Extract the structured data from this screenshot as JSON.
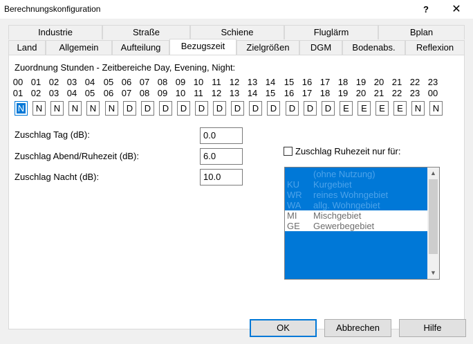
{
  "window": {
    "title": "Berechnungskonfiguration",
    "help_glyph": "?",
    "close_glyph": "✕"
  },
  "tabs": {
    "top_row": [
      "Industrie",
      "Straße",
      "Schiene",
      "Fluglärm",
      "Bplan"
    ],
    "bottom_row": [
      "Land",
      "Allgemein",
      "Aufteilung",
      "Bezugszeit",
      "Zielgrößen",
      "DGM",
      "Bodenabs.",
      "Reflexion"
    ],
    "active": "Bezugszeit"
  },
  "assignment": {
    "heading": "Zuordnung Stunden - Zeitbereiche Day, Evening, Night:",
    "hours_from": [
      "00",
      "01",
      "02",
      "03",
      "04",
      "05",
      "06",
      "07",
      "08",
      "09",
      "10",
      "11",
      "12",
      "13",
      "14",
      "15",
      "16",
      "17",
      "18",
      "19",
      "20",
      "21",
      "22",
      "23"
    ],
    "hours_to": [
      "01",
      "02",
      "03",
      "04",
      "05",
      "06",
      "07",
      "08",
      "09",
      "10",
      "11",
      "12",
      "13",
      "14",
      "15",
      "16",
      "17",
      "18",
      "19",
      "20",
      "21",
      "22",
      "23",
      "00"
    ],
    "values": [
      "N",
      "N",
      "N",
      "N",
      "N",
      "N",
      "D",
      "D",
      "D",
      "D",
      "D",
      "D",
      "D",
      "D",
      "D",
      "D",
      "D",
      "D",
      "E",
      "E",
      "E",
      "E",
      "N",
      "N"
    ],
    "selected_index": 0
  },
  "surcharges": {
    "day": {
      "label": "Zuschlag Tag (dB):",
      "value": "0.0"
    },
    "evening": {
      "label": "Zuschlag Abend/Ruhezeit (dB):",
      "value": "6.0"
    },
    "night": {
      "label": "Zuschlag Nacht (dB):",
      "value": "10.0"
    }
  },
  "rest_period": {
    "checkbox_label": "Zuschlag Ruhezeit nur für:",
    "checked": false,
    "items": [
      {
        "code": "",
        "name": "(ohne Nutzung)",
        "selected": true
      },
      {
        "code": "KU",
        "name": "Kurgebiet",
        "selected": true
      },
      {
        "code": "WR",
        "name": "reines Wohngebiet",
        "selected": true
      },
      {
        "code": "WA",
        "name": "allg. Wohngebiet",
        "selected": true
      },
      {
        "code": "MI",
        "name": "Mischgebiet",
        "selected": false
      },
      {
        "code": "GE",
        "name": "Gewerbegebiet",
        "selected": false
      }
    ]
  },
  "buttons": {
    "ok": "OK",
    "cancel": "Abbrechen",
    "help": "Hilfe"
  },
  "colors": {
    "selection": "#0078d7",
    "dialog_bg": "#f0f0f0"
  }
}
